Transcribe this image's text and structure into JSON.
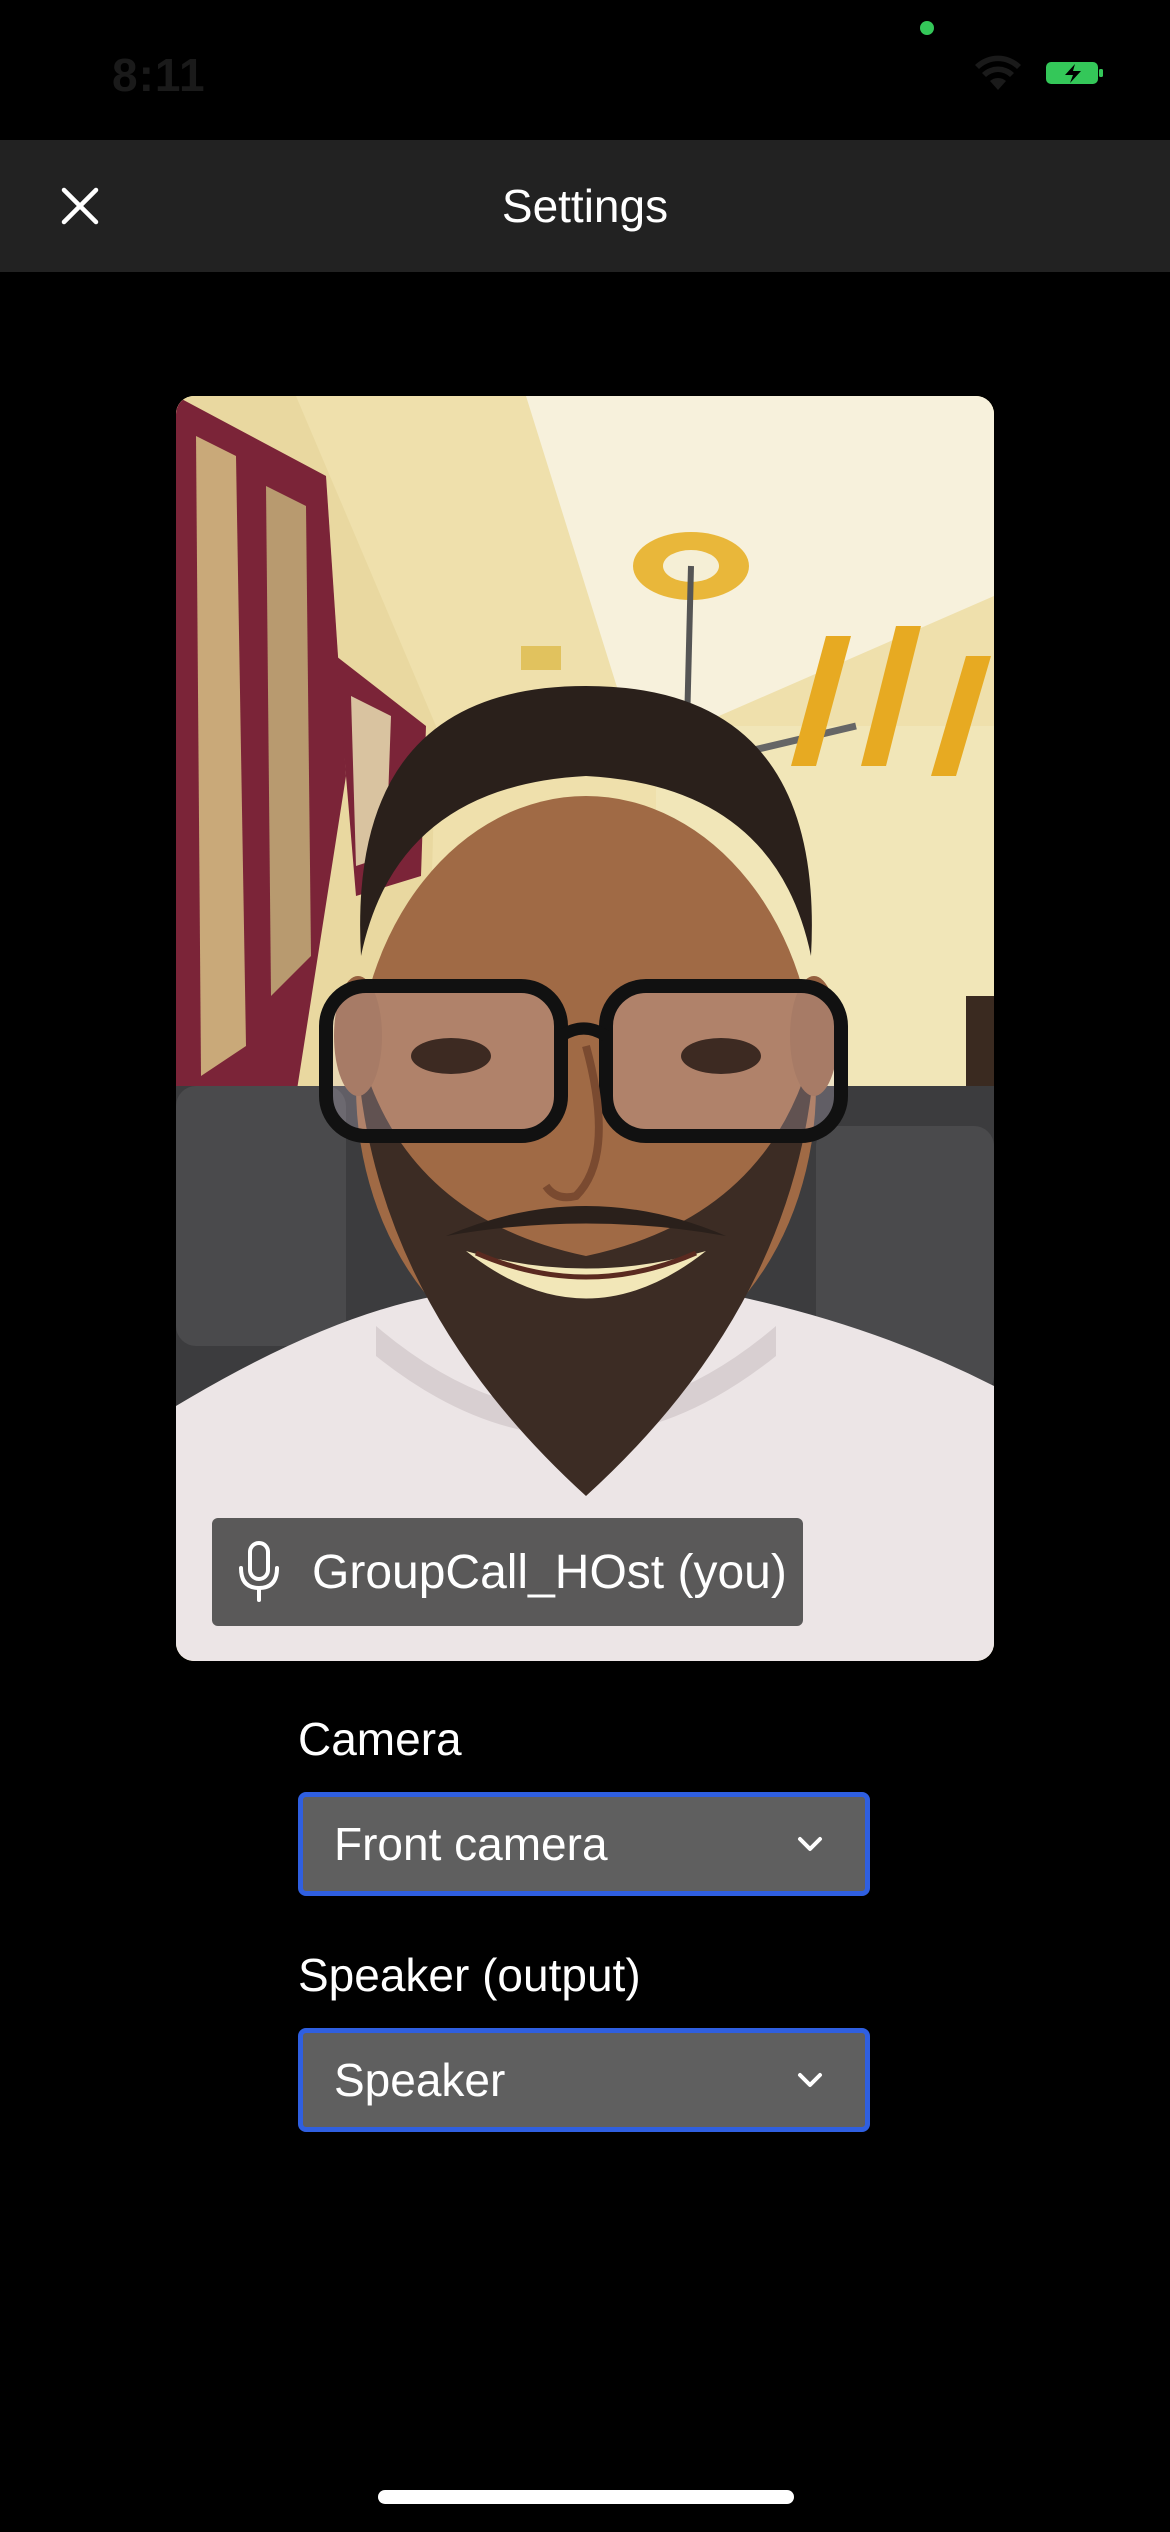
{
  "status_bar": {
    "time": "8:11",
    "wifi_icon": "wifi-icon",
    "battery_icon": "battery-charging-icon",
    "mic_active_dot_color": "#34c759",
    "battery_color": "#34c759"
  },
  "header": {
    "title": "Settings",
    "close_icon": "close-icon",
    "background": "#222222"
  },
  "preview": {
    "participant_label": "GroupCall_HOst (you)",
    "mic_icon": "microphone-icon"
  },
  "settings": {
    "camera": {
      "label": "Camera",
      "value": "Front camera"
    },
    "speaker": {
      "label": "Speaker (output)",
      "value": "Speaker"
    },
    "select_border_color": "#2f5fe0",
    "select_background": "#5f5f5f"
  }
}
